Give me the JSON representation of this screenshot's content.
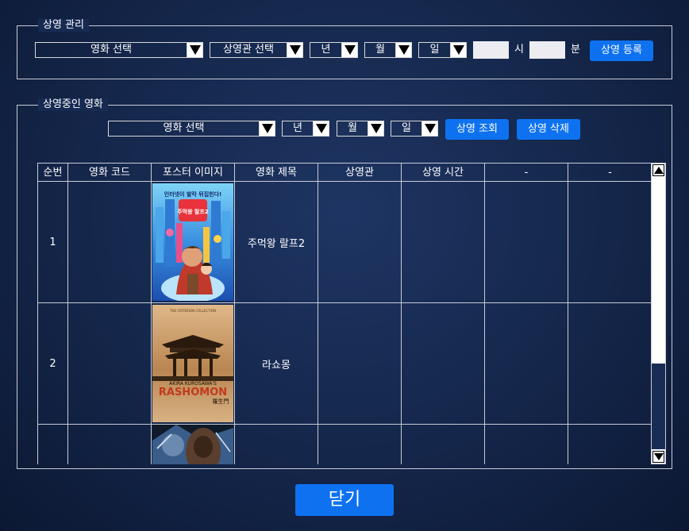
{
  "register": {
    "legend": "상영 관리",
    "movie_select": "영화 선택",
    "theater_select": "상영관 선택",
    "year_select": "년",
    "month_select": "월",
    "day_select": "일",
    "hour_value": "",
    "hour_label": "시",
    "minute_value": "",
    "minute_label": "분",
    "register_button": "상영 등록"
  },
  "current": {
    "legend": "상영중인 영화",
    "movie_select": "영화 선택",
    "year_select": "년",
    "month_select": "월",
    "day_select": "일",
    "search_button": "상영 조회",
    "delete_button": "상영 삭제"
  },
  "table": {
    "headers": [
      "순번",
      "영화 코드",
      "포스터 이미지",
      "영화 제목",
      "상영관",
      "상영 시간",
      "-",
      "-"
    ],
    "rows": [
      {
        "no": "1",
        "code": "",
        "poster": "wreck-it-ralph-2-poster",
        "title": "주먹왕 랄프2",
        "theater": "",
        "time": "",
        "extra1": "",
        "extra2": ""
      },
      {
        "no": "2",
        "code": "",
        "poster": "rashomon-poster",
        "title": "라쇼몽",
        "theater": "",
        "time": "",
        "extra1": "",
        "extra2": ""
      },
      {
        "no": "",
        "code": "",
        "poster": "glass-poster",
        "title": "",
        "theater": "",
        "time": "",
        "extra1": "",
        "extra2": ""
      }
    ],
    "poster_texts": {
      "ralph_tagline": "인터넷이 발칵 뒤집힌다!",
      "ralph_title": "주먹왕 랄프2",
      "rashomon_top": "THE CRITERION COLLECTION",
      "rashomon_director": "AKIRA KUROSAWA'S",
      "rashomon_title": "RASHOMON",
      "rashomon_kanji": "羅生門"
    }
  },
  "footer": {
    "close_button": "닫기"
  }
}
